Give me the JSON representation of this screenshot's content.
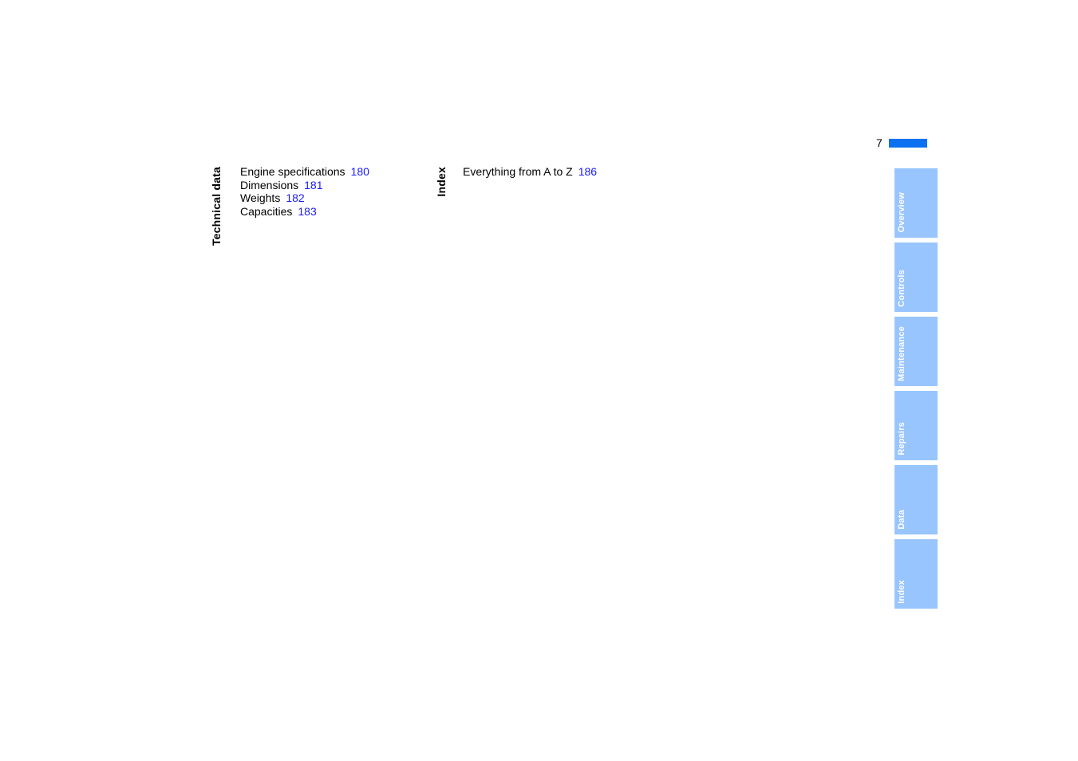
{
  "header": {
    "page_number": "7",
    "rule_color": "#0B71F0"
  },
  "colors": {
    "page_link": "#1A1AFF",
    "tab_background": "#99C5FF",
    "tab_text": "#ffffff",
    "header_rule": "#0B71F0"
  },
  "columns": [
    {
      "label": "Technical data",
      "entries": [
        {
          "title": "Engine specifications",
          "page": "180"
        },
        {
          "title": "Dimensions",
          "page": "181"
        },
        {
          "title": "Weights",
          "page": "182"
        },
        {
          "title": "Capacities",
          "page": "183"
        }
      ]
    },
    {
      "label": "Index",
      "entries": [
        {
          "title": "Everything from A to Z",
          "page": "186"
        }
      ]
    }
  ],
  "tabs": [
    {
      "label": "Overview"
    },
    {
      "label": "Controls"
    },
    {
      "label": "Maintenance"
    },
    {
      "label": "Repairs"
    },
    {
      "label": "Data"
    },
    {
      "label": "Index"
    }
  ]
}
